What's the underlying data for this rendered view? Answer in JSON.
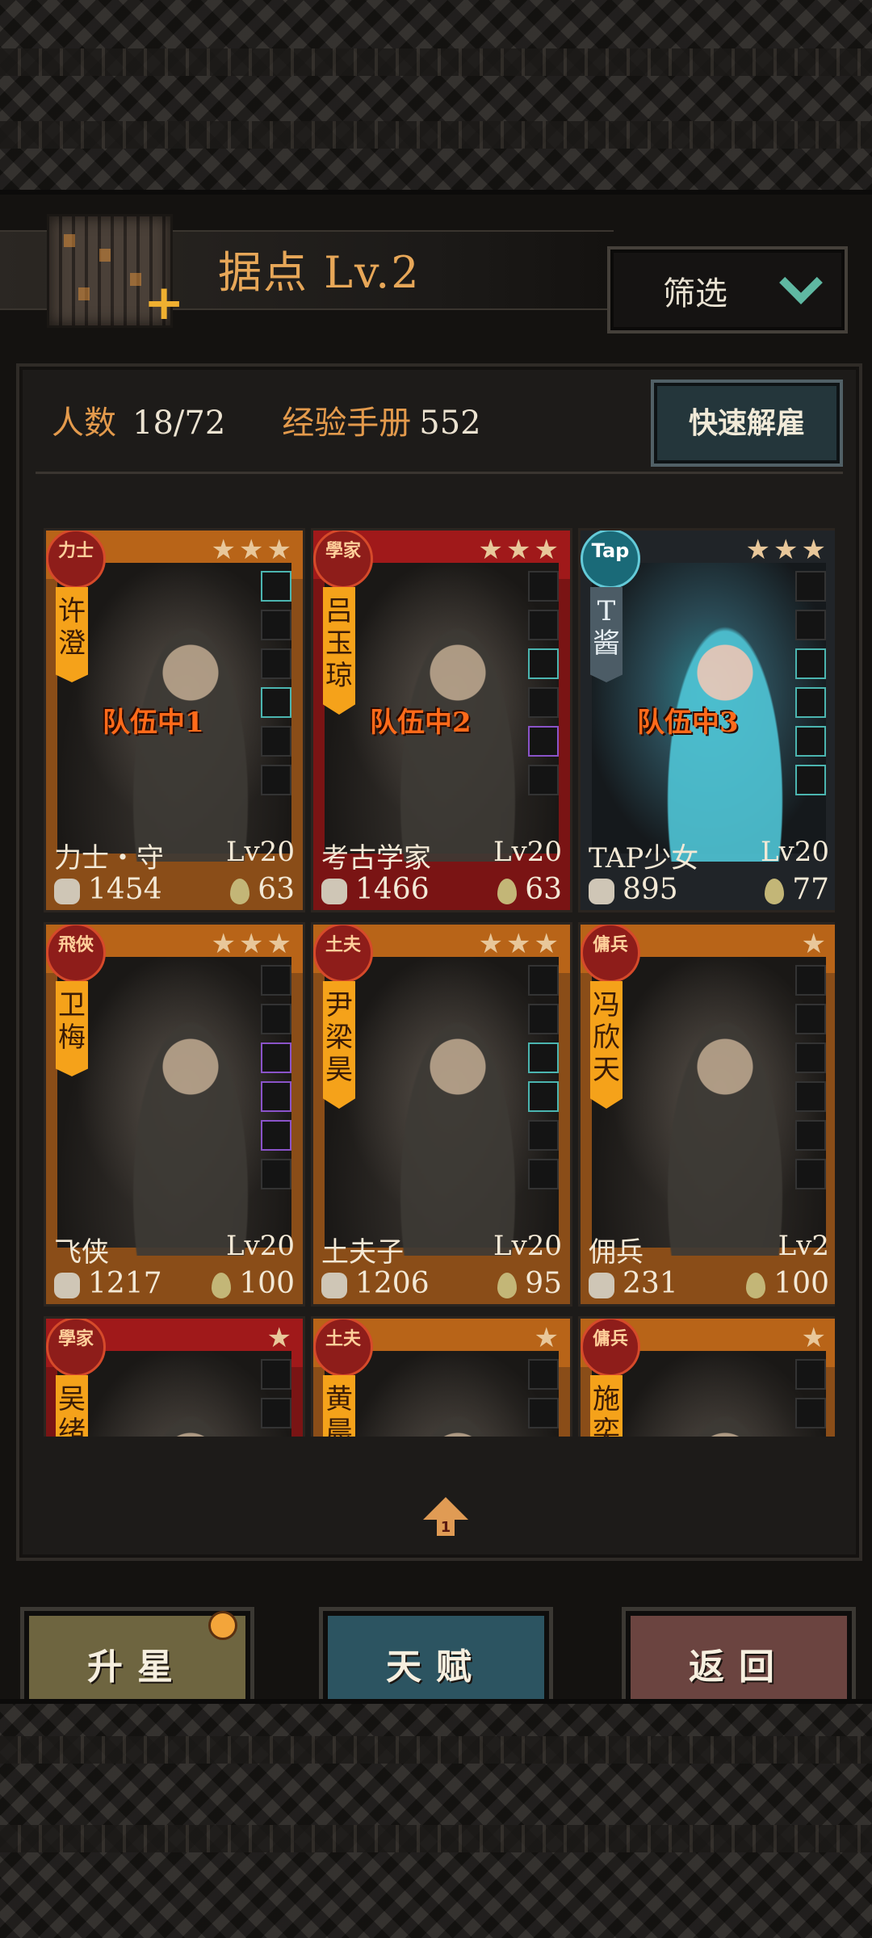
{
  "header": {
    "title": "据点 Lv.2",
    "filter_label": "筛选"
  },
  "stats": {
    "members_label": "人数",
    "members_value": "18/72",
    "exp_label": "经验手册",
    "exp_value": "552",
    "dismiss_label": "快速解雇"
  },
  "cards": [
    {
      "badge": "力士",
      "banner": "许澄",
      "stars": "★★★",
      "team": "队伍中1",
      "cls": "力士・守",
      "lv": "Lv20",
      "power": "1454",
      "drop": "63"
    },
    {
      "badge": "學家",
      "banner": "吕玉琼",
      "stars": "★★★",
      "team": "队伍中2",
      "cls": "考古学家",
      "lv": "Lv20",
      "power": "1466",
      "drop": "63"
    },
    {
      "badge": "Tap",
      "banner": "T酱",
      "stars": "★★★",
      "team": "队伍中3",
      "cls": "TAP少女",
      "lv": "Lv20",
      "power": "895",
      "drop": "77"
    },
    {
      "badge": "飛俠",
      "banner": "卫梅",
      "stars": "★★★",
      "team": "",
      "cls": "飞侠",
      "lv": "Lv20",
      "power": "1217",
      "drop": "100"
    },
    {
      "badge": "土夫",
      "banner": "尹梁昊",
      "stars": "★★★",
      "team": "",
      "cls": "土夫子",
      "lv": "Lv20",
      "power": "1206",
      "drop": "95"
    },
    {
      "badge": "傭兵",
      "banner": "冯欣天",
      "stars": "★",
      "team": "",
      "cls": "佣兵",
      "lv": "Lv2",
      "power": "231",
      "drop": "100"
    },
    {
      "badge": "學家",
      "banner": "吴绪文",
      "stars": "★",
      "team": "",
      "cls": "",
      "lv": "",
      "power": "",
      "drop": ""
    },
    {
      "badge": "土夫",
      "banner": "黄晨钊",
      "stars": "★",
      "team": "",
      "cls": "",
      "lv": "",
      "power": "",
      "drop": ""
    },
    {
      "badge": "傭兵",
      "banner": "施奕理",
      "stars": "★",
      "team": "",
      "cls": "",
      "lv": "",
      "power": "",
      "drop": ""
    }
  ],
  "scroll_indicator": "1",
  "buttons": {
    "star_up": "升星",
    "talent": "天赋",
    "back": "返回"
  }
}
